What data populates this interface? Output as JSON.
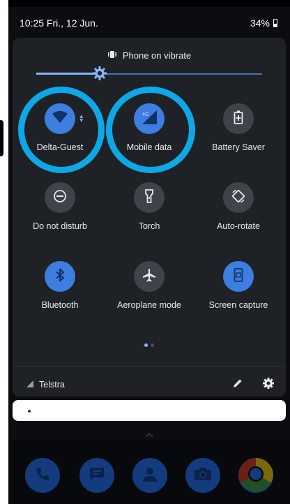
{
  "status_bar": {
    "time_date": "10:25  Fri., 12 Jun.",
    "battery": "34%"
  },
  "quick_settings": {
    "sound_mode": "Phone on vibrate",
    "brightness_level": 0.28,
    "tiles": [
      {
        "label": "Delta-Guest",
        "icon": "wifi-icon",
        "active": true,
        "highlighted": true
      },
      {
        "label": "Mobile data",
        "icon": "mobile-data-icon",
        "badge": "4G",
        "active": true,
        "highlighted": true
      },
      {
        "label": "Battery Saver",
        "icon": "battery-saver-icon",
        "active": false
      },
      {
        "label": "Do not disturb",
        "icon": "do-not-disturb-icon",
        "active": false
      },
      {
        "label": "Torch",
        "icon": "torch-icon",
        "active": false
      },
      {
        "label": "Auto-rotate",
        "icon": "auto-rotate-icon",
        "active": false
      },
      {
        "label": "Bluetooth",
        "icon": "bluetooth-icon",
        "active": true
      },
      {
        "label": "Aeroplane mode",
        "icon": "aeroplane-icon",
        "active": false
      },
      {
        "label": "Screen capture",
        "icon": "screen-capture-icon",
        "active": true
      }
    ],
    "page_indicator": {
      "pages": 2,
      "current": 1
    },
    "carrier": "Telstra"
  },
  "dock": [
    {
      "icon": "phone-icon"
    },
    {
      "icon": "messages-icon"
    },
    {
      "icon": "contacts-icon"
    },
    {
      "icon": "camera-icon"
    },
    {
      "icon": "chrome-icon"
    }
  ],
  "colors": {
    "accent": "#3d7ee0",
    "highlight_ring": "#0fa8e6",
    "panel": "#1e2226",
    "tile_off": "#40444a"
  }
}
